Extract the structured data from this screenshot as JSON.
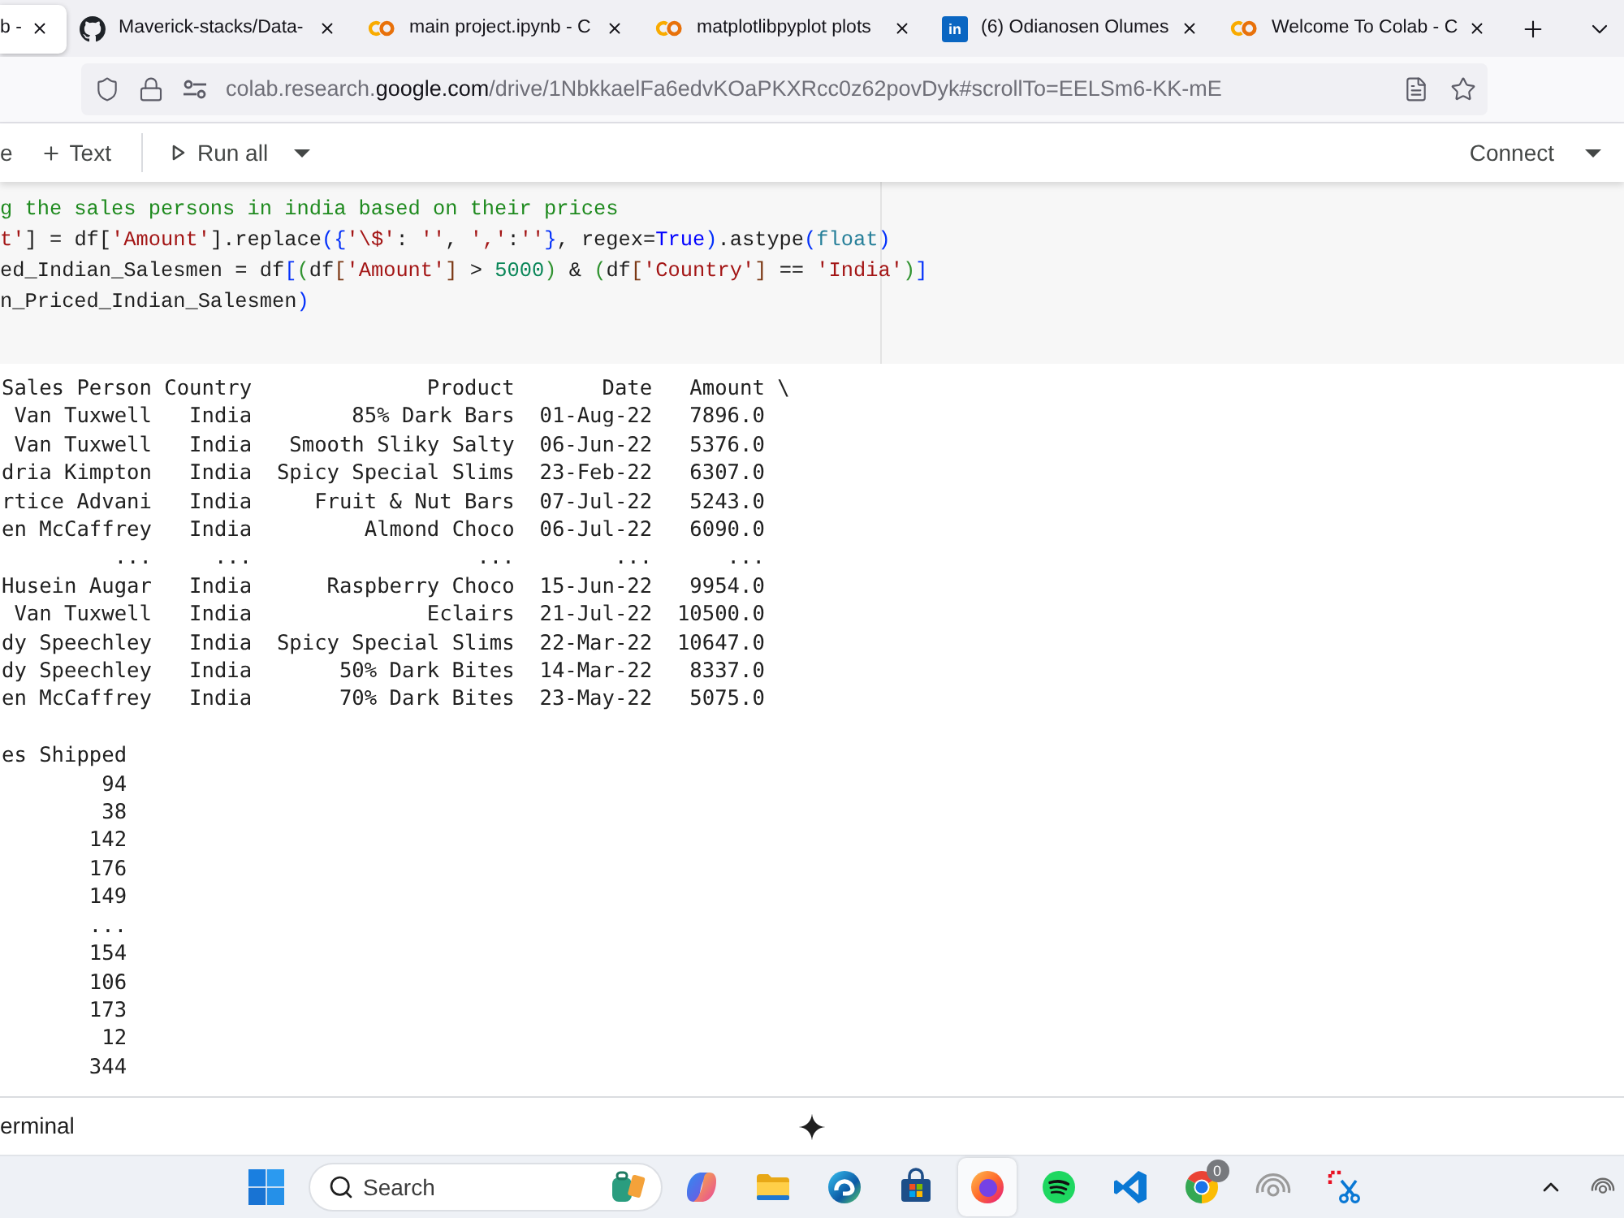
{
  "browser": {
    "tabs": [
      {
        "title": "b -",
        "kind": "none",
        "selected": true
      },
      {
        "title": "Maverick-stacks/Data-",
        "kind": "github",
        "selected": false
      },
      {
        "title": "main project.ipynb - C",
        "kind": "colab",
        "selected": false
      },
      {
        "title": "matplotlibpyplot plots",
        "kind": "colab",
        "selected": false
      },
      {
        "title": "(6) Odianosen Olumes",
        "kind": "linkedin",
        "logo_text": "in",
        "selected": false
      },
      {
        "title": "Welcome To Colab - C",
        "kind": "colab",
        "selected": false
      }
    ],
    "url": {
      "host_start": "colab.research.",
      "domain": "google.com",
      "path": "/drive/1NbkkaelFa6edvKOaPKXRcc0z62povDyk#scrollTo=EELSm6-KK-mE"
    }
  },
  "toolbar": {
    "items": [
      {
        "kind": "cut",
        "label": "e"
      },
      {
        "kind": "add",
        "label": "Text"
      },
      {
        "kind": "run",
        "label": "Run all"
      }
    ],
    "connect": {
      "label": "Connect"
    }
  },
  "code_cell": {
    "lines": [
      [
        {
          "kind": "comment",
          "text": "g the sales persons in india based on their prices"
        }
      ],
      [
        {
          "kind": "string",
          "text": "t'"
        },
        {
          "kind": "plain",
          "text": "] = df["
        },
        {
          "kind": "string",
          "text": "'Amount'"
        },
        {
          "kind": "plain",
          "text": "].replace"
        },
        {
          "kind": "bracket1",
          "text": "({"
        },
        {
          "kind": "string",
          "text": "'\\$'"
        },
        {
          "kind": "plain",
          "text": ": "
        },
        {
          "kind": "string",
          "text": "''"
        },
        {
          "kind": "plain",
          "text": ", "
        },
        {
          "kind": "string",
          "text": "','"
        },
        {
          "kind": "plain",
          "text": ":"
        },
        {
          "kind": "string",
          "text": "''"
        },
        {
          "kind": "bracket1",
          "text": "}"
        },
        {
          "kind": "plain",
          "text": ", regex="
        },
        {
          "kind": "keyword",
          "text": "True"
        },
        {
          "kind": "bracket1",
          "text": ")"
        },
        {
          "kind": "plain",
          "text": ".astype"
        },
        {
          "kind": "bracket1",
          "text": "("
        },
        {
          "kind": "builtin",
          "text": "float"
        },
        {
          "kind": "bracket1",
          "text": ")"
        }
      ],
      [
        {
          "kind": "plain",
          "text": "ed_Indian_Salesmen = df"
        },
        {
          "kind": "bracket1",
          "text": "["
        },
        {
          "kind": "bracket2",
          "text": "("
        },
        {
          "kind": "plain",
          "text": "df"
        },
        {
          "kind": "bracket3",
          "text": "["
        },
        {
          "kind": "string",
          "text": "'Amount'"
        },
        {
          "kind": "bracket3",
          "text": "]"
        },
        {
          "kind": "plain",
          "text": " > "
        },
        {
          "kind": "number",
          "text": "5000"
        },
        {
          "kind": "bracket2",
          "text": ")"
        },
        {
          "kind": "plain",
          "text": " & "
        },
        {
          "kind": "bracket2",
          "text": "("
        },
        {
          "kind": "plain",
          "text": "df"
        },
        {
          "kind": "bracket3",
          "text": "["
        },
        {
          "kind": "string",
          "text": "'Country'"
        },
        {
          "kind": "bracket3",
          "text": "]"
        },
        {
          "kind": "plain",
          "text": " == "
        },
        {
          "kind": "string",
          "text": "'India'"
        },
        {
          "kind": "bracket2",
          "text": ")"
        },
        {
          "kind": "bracket1",
          "text": "]"
        }
      ],
      [
        {
          "kind": "plain",
          "text": "n_Priced_Indian_Salesmen"
        },
        {
          "kind": "bracket1",
          "text": ")"
        }
      ]
    ]
  },
  "output": {
    "table": {
      "columns": [
        "Sales Person",
        "Country",
        "Product",
        "Date",
        "Amount"
      ],
      "continuation": "\\",
      "rows": [
        [
          "Van Tuxwell",
          "India",
          "85% Dark Bars",
          "01-Aug-22",
          "7896.0"
        ],
        [
          "Van Tuxwell",
          "India",
          "Smooth Sliky Salty",
          "06-Jun-22",
          "5376.0"
        ],
        [
          "dria Kimpton",
          "India",
          "Spicy Special Slims",
          "23-Feb-22",
          "6307.0"
        ],
        [
          "rtice Advani",
          "India",
          "Fruit & Nut Bars",
          "07-Jul-22",
          "5243.0"
        ],
        [
          "en McCaffrey",
          "India",
          "Almond Choco",
          "06-Jul-22",
          "6090.0"
        ],
        [
          "...",
          "...",
          "...",
          "...",
          "..."
        ],
        [
          "Husein Augar",
          "India",
          "Raspberry Choco",
          "15-Jun-22",
          "9954.0"
        ],
        [
          "Van Tuxwell",
          "India",
          "Eclairs",
          "21-Jul-22",
          "10500.0"
        ],
        [
          "dy Speechley",
          "India",
          "Spicy Special Slims",
          "22-Mar-22",
          "10647.0"
        ],
        [
          "dy Speechley",
          "India",
          "50% Dark Bites",
          "14-Mar-22",
          "8337.0"
        ],
        [
          "en McCaffrey",
          "India",
          "70% Dark Bites",
          "23-May-22",
          "5075.0"
        ]
      ]
    },
    "table_2": {
      "columns": [
        "es Shipped"
      ],
      "rows": [
        [
          "94"
        ],
        [
          "38"
        ],
        [
          "142"
        ],
        [
          "176"
        ],
        [
          "149"
        ],
        [
          "..."
        ],
        [
          "154"
        ],
        [
          "106"
        ],
        [
          "173"
        ],
        [
          "12"
        ],
        [
          "344"
        ]
      ]
    }
  },
  "bottom_bar": {
    "tab": "erminal"
  },
  "taskbar": {
    "search": {
      "placeholder": "Search"
    },
    "apps": [
      {
        "kind": "copilot",
        "active": false
      },
      {
        "kind": "explorer",
        "active": false
      },
      {
        "kind": "edge",
        "active": false
      },
      {
        "kind": "store",
        "active": false
      },
      {
        "kind": "firefox",
        "active": true
      },
      {
        "kind": "spotify",
        "active": false
      },
      {
        "kind": "vscode",
        "active": false
      },
      {
        "kind": "chrome",
        "active": false,
        "badge": "0"
      },
      {
        "kind": "rings",
        "active": false
      },
      {
        "kind": "snip",
        "active": false
      }
    ]
  }
}
